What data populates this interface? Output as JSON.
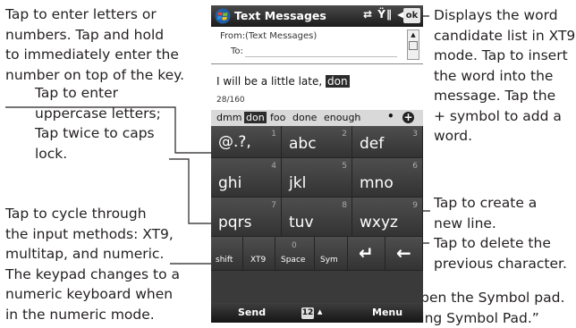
{
  "callouts": {
    "enter_letters": [
      "Tap to enter letters or",
      "numbers. Tap and hold",
      "to immediately enter the",
      "number on top of the key."
    ],
    "uppercase": [
      "Tap to enter",
      "uppercase letters;",
      "Tap twice to caps",
      "lock."
    ],
    "cycle_input": [
      "Tap to cycle through",
      "the input methods: XT9,",
      "multitap, and numeric.",
      "The keypad changes to a",
      "numeric keyboard when",
      "in the numeric mode."
    ],
    "candidate_list": [
      "Displays the word",
      "candidate list in XT9",
      "mode. Tap to insert",
      "the word into the",
      "message. Tap the",
      "+ symbol to add a",
      "word."
    ],
    "new_line": [
      "Tap to create a",
      "new line."
    ],
    "delete": [
      "Tap to delete the",
      "previous character."
    ],
    "symbol_pad": [
      "Tap to open the Symbol pad.",
      "See “Using Symbol Pad.”"
    ]
  },
  "phone": {
    "title": "Text Messages",
    "status_icons": "⇄ Ÿ∥ ◀‹",
    "ok": "ok",
    "from_label": "From:",
    "from_value": "(Text Messages)",
    "to_label": "To:",
    "message_prefix": "I will be a little late, ",
    "message_highlight": "don",
    "counter": "28/160",
    "candidates": [
      "dmm",
      "don",
      "foo",
      "done",
      "enough"
    ],
    "candidate_more": "•",
    "candidate_add": "+",
    "keys": {
      "k1": {
        "label": "@.?,",
        "num": "1"
      },
      "k2": {
        "label": "abc",
        "num": "2"
      },
      "k3": {
        "label": "def",
        "num": "3"
      },
      "k4": {
        "label": "ghi",
        "num": "4"
      },
      "k5": {
        "label": "jkl",
        "num": "5"
      },
      "k6": {
        "label": "mno",
        "num": "6"
      },
      "k7": {
        "label": "pqrs",
        "num": "7"
      },
      "k8": {
        "label": "tuv",
        "num": "8"
      },
      "k9": {
        "label": "wxyz",
        "num": "9"
      },
      "shift": "shift",
      "xt9": "XT9",
      "space": "Space",
      "space_num": "0",
      "sym": "Sym",
      "enter": "↵",
      "backspace": "←"
    },
    "softkeys": {
      "left": "Send",
      "input_icon": "12",
      "input_arrow": "▴",
      "right": "Menu"
    }
  }
}
